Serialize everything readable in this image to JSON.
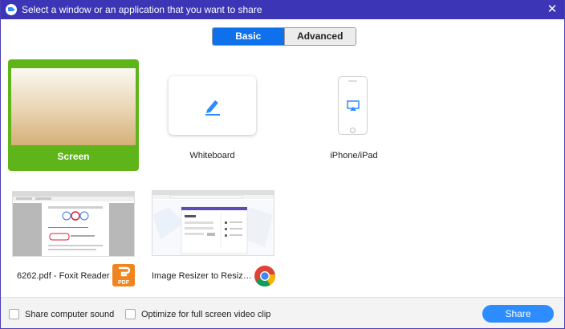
{
  "window": {
    "title": "Select a window or an application that you want to share",
    "close_glyph": "✕"
  },
  "tabs": [
    {
      "label": "Basic",
      "active": true
    },
    {
      "label": "Advanced",
      "active": false
    }
  ],
  "options": {
    "screen": {
      "label": "Screen",
      "selected": true
    },
    "whiteboard": {
      "label": "Whiteboard",
      "icon": "pen-icon"
    },
    "iphone": {
      "label": "iPhone/iPad",
      "icon": "airplay-icon"
    }
  },
  "windows": [
    {
      "label": "6262.pdf - Foxit Reader",
      "app_icon": "foxit-pdf-icon",
      "badge_text": "PDF"
    },
    {
      "label": "Image Resizer to Resize a...",
      "app_icon": "chrome-icon"
    }
  ],
  "footer": {
    "share_sound": "Share computer sound",
    "optimize_video": "Optimize for full screen video clip",
    "share_button": "Share"
  },
  "colors": {
    "titlebar": "#3c35b5",
    "accent": "#0e71eb",
    "selected_tile": "#5fb41a",
    "share_button": "#2d8cff"
  }
}
